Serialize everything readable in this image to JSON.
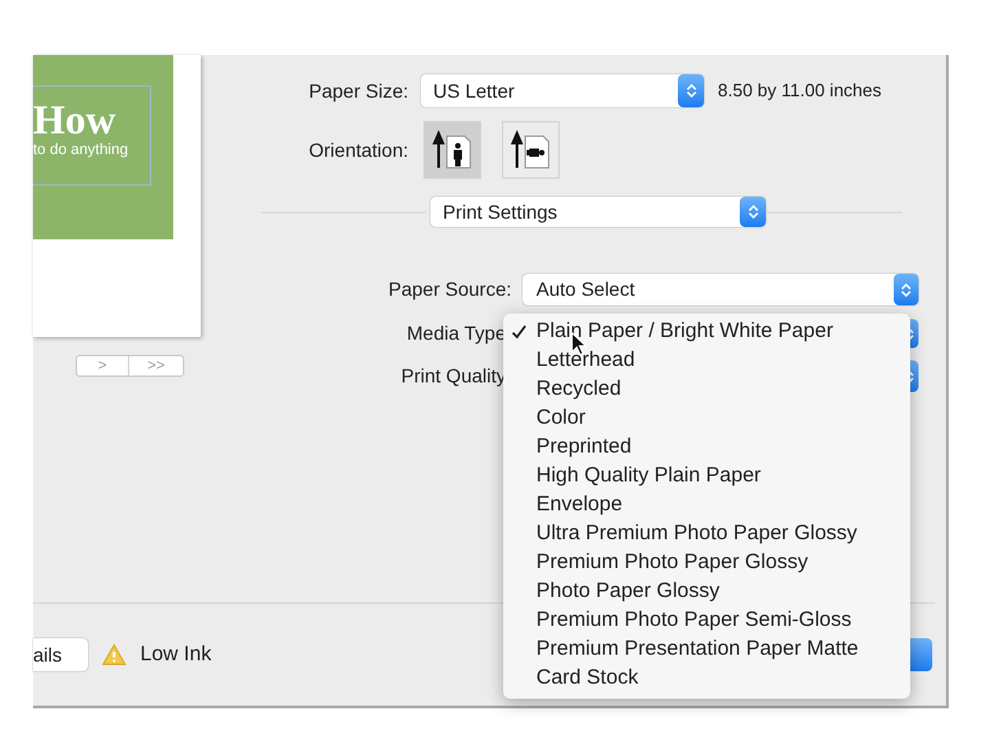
{
  "preview": {
    "title": "How",
    "subtitle": "to do anything",
    "nav": [
      ">",
      ">>"
    ]
  },
  "paper_size": {
    "label": "Paper Size:",
    "value": "US Letter",
    "dimensions": "8.50 by 11.00 inches"
  },
  "orientation": {
    "label": "Orientation:",
    "options": [
      {
        "kind": "portrait",
        "selected": true
      },
      {
        "kind": "landscape",
        "selected": false
      }
    ]
  },
  "section_popup": {
    "value": "Print Settings"
  },
  "paper_source": {
    "label": "Paper Source:",
    "value": "Auto Select"
  },
  "media_type": {
    "label": "Media Type"
  },
  "print_quality": {
    "label": "Print Quality"
  },
  "media_menu": {
    "items": [
      {
        "label": "Plain Paper / Bright White Paper",
        "selected": true
      },
      {
        "label": "Letterhead",
        "selected": false
      },
      {
        "label": "Recycled",
        "selected": false
      },
      {
        "label": "Color",
        "selected": false
      },
      {
        "label": "Preprinted",
        "selected": false
      },
      {
        "label": "High Quality Plain Paper",
        "selected": false
      },
      {
        "label": "Envelope",
        "selected": false
      },
      {
        "label": "Ultra Premium Photo Paper Glossy",
        "selected": false
      },
      {
        "label": "Premium Photo Paper Glossy",
        "selected": false
      },
      {
        "label": "Photo Paper Glossy",
        "selected": false
      },
      {
        "label": "Premium Photo Paper Semi-Gloss",
        "selected": false
      },
      {
        "label": "Premium Presentation Paper Matte",
        "selected": false
      },
      {
        "label": "Card Stock",
        "selected": false
      }
    ]
  },
  "footer": {
    "details_button": "ails",
    "warning": "Low Ink"
  }
}
